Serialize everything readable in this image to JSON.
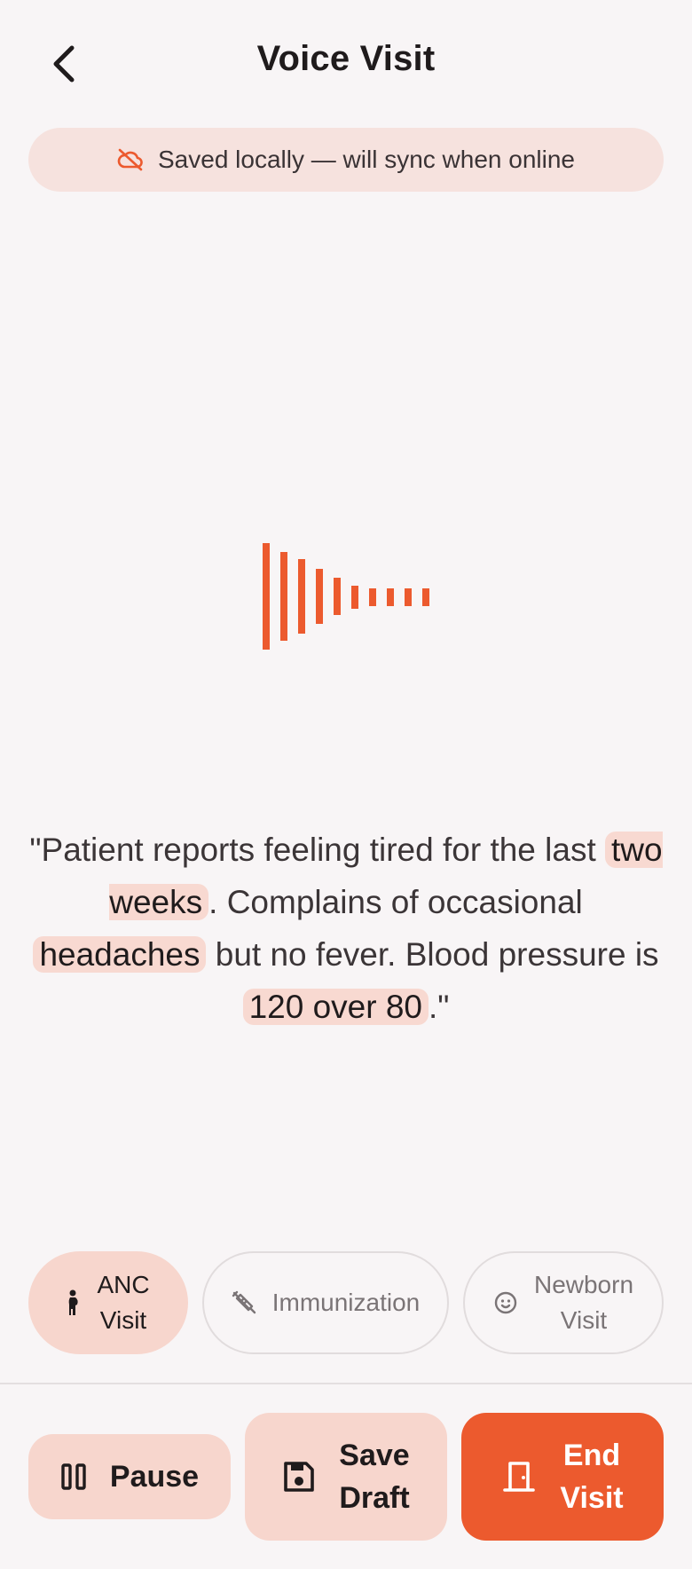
{
  "header": {
    "title": "Voice Visit",
    "back_icon": "chevron-left-icon"
  },
  "banner": {
    "icon": "cloud-off-icon",
    "text": "Saved locally — will sync when online"
  },
  "recorder": {
    "state_icon": "audio-waveform-icon",
    "accent": "#ec5a2e"
  },
  "transcript": {
    "open_quote": "\"",
    "part1": "Patient reports feeling tired for the last ",
    "highlight1": "two weeks",
    "part2": ". Complains of occasional ",
    "highlight2": "headaches",
    "part3": " but no fever. Blood pressure is ",
    "highlight3": "120 over 80",
    "close": ".\""
  },
  "visit_types": [
    {
      "line1": "ANC",
      "line2": "Visit",
      "icon": "pregnant-person-icon",
      "selected": true
    },
    {
      "line1": "Immunization",
      "line2": "",
      "icon": "syringe-icon",
      "selected": false
    },
    {
      "line1": "Newborn",
      "line2": "Visit",
      "icon": "baby-face-icon",
      "selected": false
    }
  ],
  "actions": {
    "pause": {
      "label": "Pause",
      "icon": "pause-icon"
    },
    "save": {
      "line1": "Save",
      "line2": "Draft",
      "icon": "save-icon"
    },
    "end": {
      "line1": "End",
      "line2": "Visit",
      "icon": "door-exit-icon"
    }
  },
  "colors": {
    "accent": "#ec5a2e",
    "accent_soft": "#f7d6cd",
    "background": "#f8f5f6"
  }
}
